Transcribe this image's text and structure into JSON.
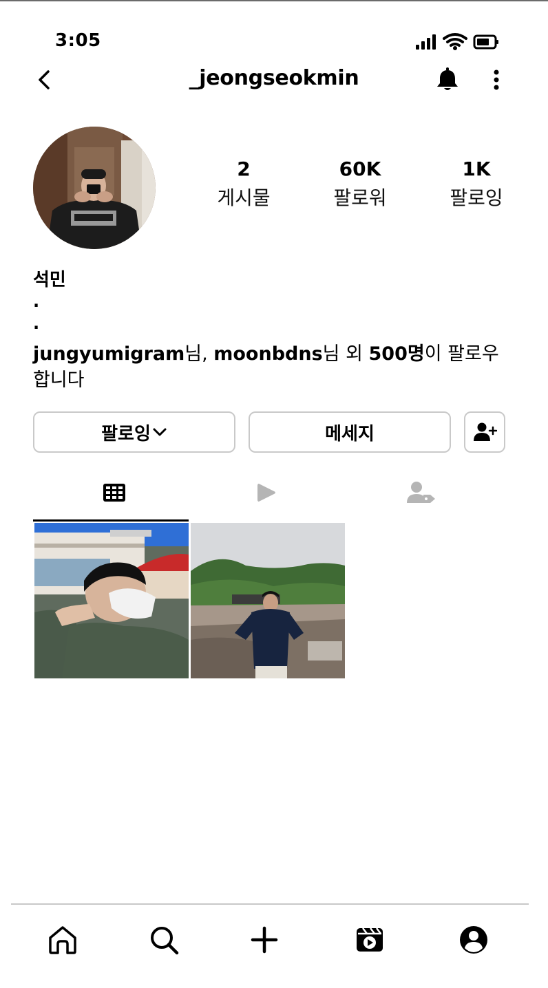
{
  "status_bar": {
    "time": "3:05",
    "icons": [
      "signal-icon",
      "wifi-icon",
      "battery-icon"
    ]
  },
  "header": {
    "username": "_jeongseokmin",
    "icons": [
      "back-arrow-icon",
      "bell-icon",
      "more-vertical-icon"
    ]
  },
  "profile": {
    "stats": [
      {
        "value": "2",
        "label": "게시물"
      },
      {
        "value": "60K",
        "label": "팔로워"
      },
      {
        "value": "1K",
        "label": "팔로잉"
      }
    ],
    "display_name": "석민",
    "bio_lines": [
      ".",
      "."
    ],
    "followed_by": {
      "user1": "jungyumigram",
      "suffix1": "님, ",
      "user2": "moonbdns",
      "suffix2": "님 외 ",
      "count": "500명",
      "suffix3": "이 팔로우합니다"
    }
  },
  "actions": {
    "following_label": "팔로잉",
    "message_label": "메세지",
    "icons": [
      "chevron-down-icon",
      "add-person-icon"
    ]
  },
  "tabs": {
    "icons": [
      "grid-icon",
      "reels-play-icon",
      "tagged-person-icon"
    ],
    "active_index": 0
  },
  "posts": [
    {
      "alt": "photo-selfie-with-mask"
    },
    {
      "alt": "photo-standing-outdoors"
    }
  ],
  "bottom_nav": {
    "icons": [
      "home-icon",
      "search-icon",
      "create-plus-icon",
      "reels-icon",
      "profile-icon"
    ]
  },
  "colors": {
    "text": "#000000",
    "muted_icon": "#b5b5b5",
    "button_border": "#c9c9c9",
    "divider": "#c8c8c8"
  }
}
